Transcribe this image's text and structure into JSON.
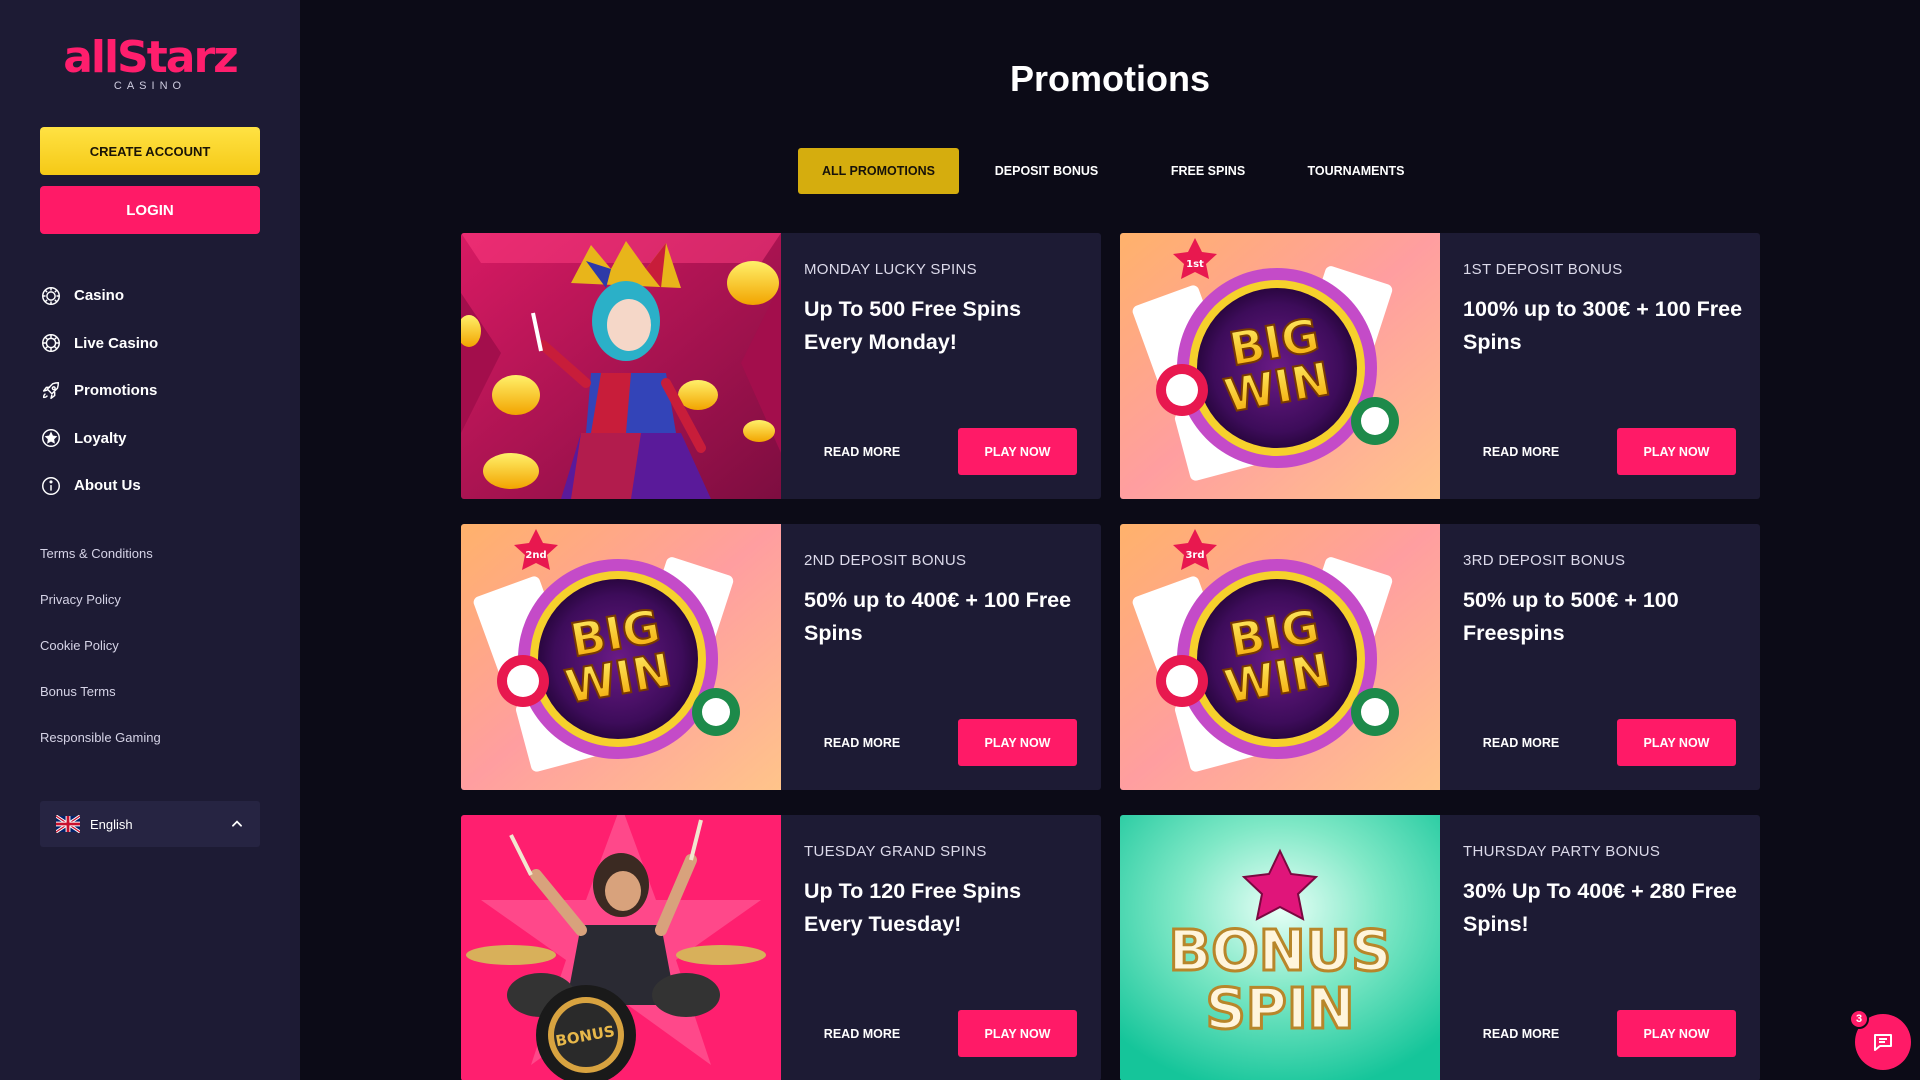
{
  "brand": {
    "logo_text": "allStarz",
    "logo_sub": "CASINO"
  },
  "sidebar": {
    "create_account": "CREATE ACCOUNT",
    "login": "LOGIN",
    "nav": [
      {
        "label": "Casino",
        "icon": "casino-chip-icon"
      },
      {
        "label": "Live Casino",
        "icon": "live-casino-icon"
      },
      {
        "label": "Promotions",
        "icon": "rocket-icon"
      },
      {
        "label": "Loyalty",
        "icon": "star-circle-icon"
      },
      {
        "label": "About Us",
        "icon": "info-icon"
      }
    ],
    "links": [
      "Terms & Conditions",
      "Privacy Policy",
      "Cookie Policy",
      "Bonus Terms",
      "Responsible Gaming"
    ],
    "language": "English"
  },
  "main": {
    "title": "Promotions",
    "tabs": [
      "ALL PROMOTIONS",
      "DEPOSIT BONUS",
      "FREE SPINS",
      "TOURNAMENTS"
    ]
  },
  "promos": [
    {
      "kicker": "MONDAY LUCKY SPINS",
      "headline": "Up To 500 Free Spins Every Monday!",
      "read_more": "READ MORE",
      "play_now": "PLAY NOW",
      "art": "jester-character"
    },
    {
      "kicker": "1ST DEPOSIT BONUS",
      "headline": "100% up to 300€ + 100 Free Spins",
      "read_more": "READ MORE",
      "play_now": "PLAY NOW",
      "art": "big-win-wheel",
      "badge": "1st"
    },
    {
      "kicker": "2ND DEPOSIT BONUS",
      "headline": "50% up to 400€ + 100 Free Spins",
      "read_more": "READ MORE",
      "play_now": "PLAY NOW",
      "art": "big-win-wheel",
      "badge": "2nd"
    },
    {
      "kicker": "3RD DEPOSIT BONUS",
      "headline": "50% up to 500€ + 100 Freespins",
      "read_more": "READ MORE",
      "play_now": "PLAY NOW",
      "art": "big-win-wheel",
      "badge": "3rd"
    },
    {
      "kicker": "TUESDAY GRAND SPINS",
      "headline": "Up To 120 Free Spins Every Tuesday!",
      "read_more": "READ MORE",
      "play_now": "PLAY NOW",
      "art": "drummer-character",
      "drum_text": "BONUS"
    },
    {
      "kicker": "THURSDAY PARTY BONUS",
      "headline": "30% Up To 400€ + 280 Free Spins!",
      "read_more": "READ MORE",
      "play_now": "PLAY NOW",
      "art": "bonus-spin-text",
      "art_text_1": "BONUS",
      "art_text_2": "SPIN"
    }
  ],
  "art_text": {
    "big": "BIG",
    "win": "WIN"
  },
  "chat": {
    "unread": "3",
    "icon": "chat-icon"
  },
  "colors": {
    "accent_pink": "#ff1a67",
    "accent_yellow": "#d5ad0e",
    "sidebar_bg": "#1d1b34",
    "page_bg": "#0c0b17"
  }
}
